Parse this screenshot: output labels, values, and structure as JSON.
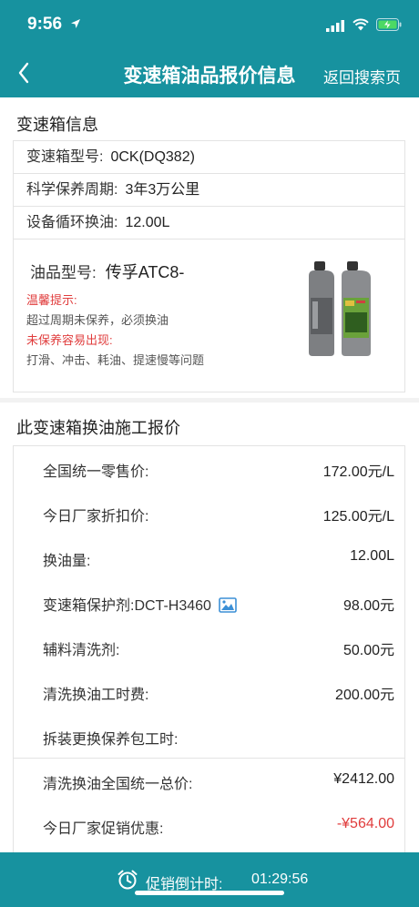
{
  "status_bar": {
    "time": "9:56"
  },
  "header": {
    "title": "变速箱油品报价信息",
    "right_link": "返回搜索页"
  },
  "info": {
    "section_title": "变速箱信息",
    "rows": [
      {
        "label": "变速箱型号:",
        "value": "0CK(DQ382)"
      },
      {
        "label": "科学保养周期:",
        "value": "3年3万公里"
      },
      {
        "label": "设备循环换油:",
        "value": "12.00L"
      }
    ],
    "oil_model_label": "油品型号:",
    "oil_model_value": "传孚ATC8-",
    "tip_title": "温馨提示:",
    "tip_text": "超过周期未保养，必须换油",
    "warn_title": "未保养容易出现:",
    "warn_text": "打滑、冲击、耗油、提速慢等问题"
  },
  "quote": {
    "section_title": "此变速箱换油施工报价",
    "rows": [
      {
        "label": "全国统一零售价:",
        "amount": "172.00元/L"
      },
      {
        "label": "今日厂家折扣价:",
        "amount": "125.00元/L"
      },
      {
        "label": "换油量:",
        "amount": "12.00L"
      },
      {
        "label": "变速箱保护剂:DCT-H3460",
        "amount": "98.00元"
      },
      {
        "label": "辅料清洗剂:",
        "amount": "50.00元"
      },
      {
        "label": "清洗换油工时费:",
        "amount": "200.00元"
      },
      {
        "label": "拆装更换保养包工时:",
        "amount": ""
      },
      {
        "label": "清洗换油全国统一总价:",
        "amount": "¥2412.00"
      },
      {
        "label": "今日厂家促销优惠:",
        "amount": "-¥564.00"
      }
    ]
  },
  "footer": {
    "countdown_label": "促销倒计时:",
    "countdown_time": "01:29:56"
  },
  "colors": {
    "brand": "#17929f",
    "alert": "#e03c3c"
  }
}
